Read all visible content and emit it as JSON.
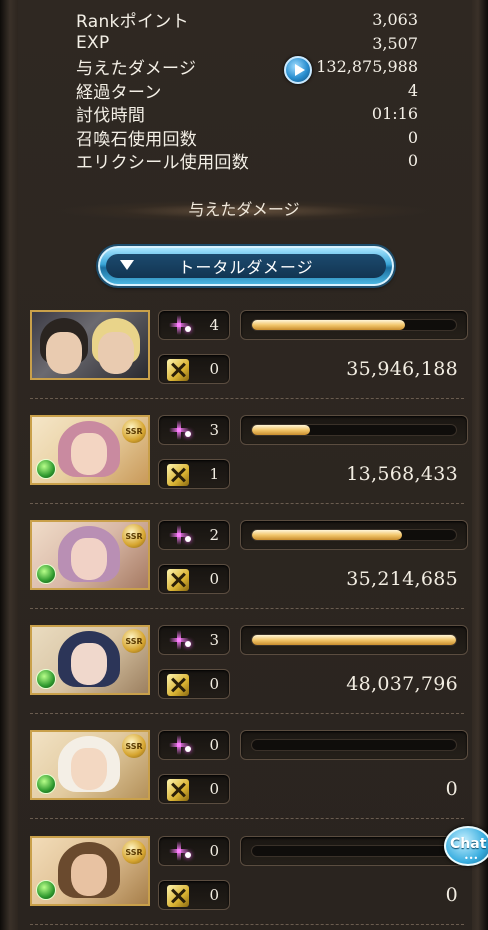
{
  "stats": [
    {
      "label": "Rankポイント",
      "value": "3,063"
    },
    {
      "label": "EXP",
      "value": "3,507"
    },
    {
      "label": "与えたダメージ",
      "value": "132,875,988"
    },
    {
      "label": "経過ターン",
      "value": "4"
    },
    {
      "label": "討伐時間",
      "value": "01:16"
    },
    {
      "label": "召喚石使用回数",
      "value": "0"
    },
    {
      "label": "エリクシール使用回数",
      "value": "0"
    }
  ],
  "section": {
    "title": "与えたダメージ"
  },
  "total_button": {
    "label": "トータルダメージ"
  },
  "characters": [
    {
      "name": "main-character",
      "ougi_count": "4",
      "chain_count": "0",
      "damage": "35,946,188",
      "damage_ratio": 0.748,
      "portrait_icon": "duo-portrait",
      "rarity": "",
      "element": ""
    },
    {
      "name": "character-2",
      "ougi_count": "3",
      "chain_count": "1",
      "damage": "13,568,433",
      "damage_ratio": 0.282,
      "portrait_icon": "pink-hair-portrait",
      "rarity": "SSR",
      "element": "wind"
    },
    {
      "name": "character-3",
      "ougi_count": "2",
      "chain_count": "0",
      "damage": "35,214,685",
      "damage_ratio": 0.733,
      "portrait_icon": "horned-portrait",
      "rarity": "SSR",
      "element": "wind"
    },
    {
      "name": "character-4",
      "ougi_count": "3",
      "chain_count": "0",
      "damage": "48,037,796",
      "damage_ratio": 1.0,
      "portrait_icon": "hooded-portrait",
      "rarity": "SSR",
      "element": "wind"
    },
    {
      "name": "character-5",
      "ougi_count": "0",
      "chain_count": "0",
      "damage": "0",
      "damage_ratio": 0,
      "portrait_icon": "elder-portrait",
      "rarity": "SSR",
      "element": "wind"
    },
    {
      "name": "character-6",
      "ougi_count": "0",
      "chain_count": "0",
      "damage": "0",
      "damage_ratio": 0,
      "portrait_icon": "bearded-portrait",
      "rarity": "SSR",
      "element": "wind"
    }
  ],
  "chat": {
    "label": "Chat"
  },
  "colors": {
    "bar_fill": "#f3c76d",
    "accent_blue": "#3aa6d8",
    "frame_gold": "#c9a04a"
  }
}
